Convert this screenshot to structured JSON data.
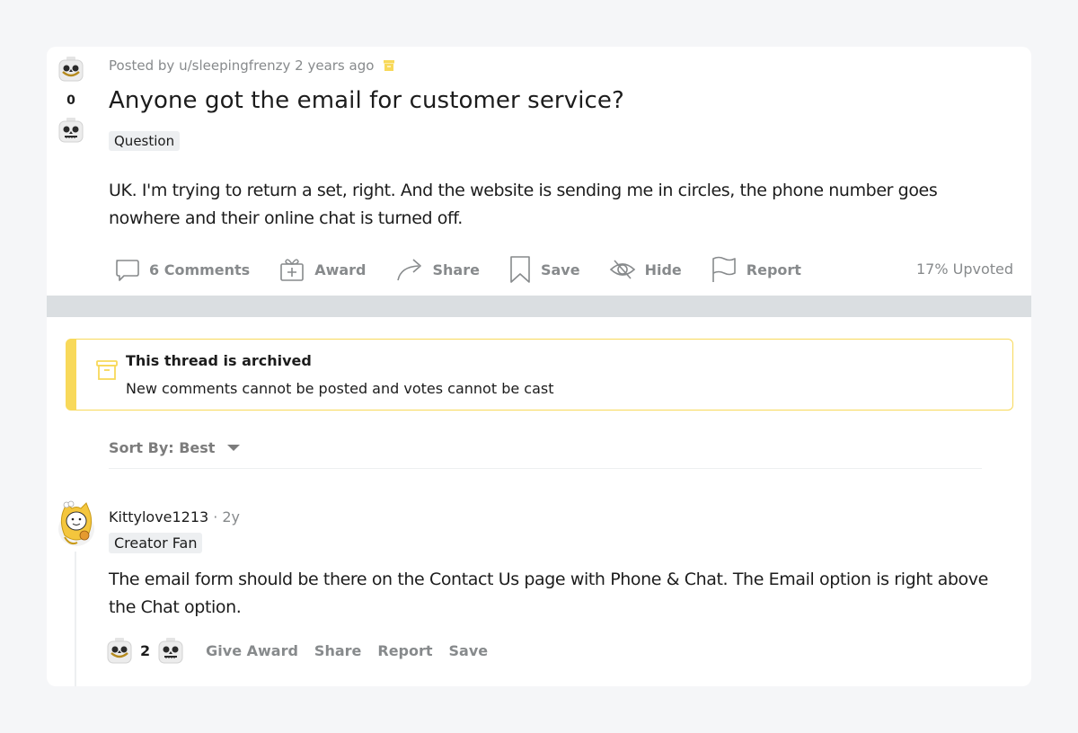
{
  "post": {
    "vote_count": "0",
    "meta": "Posted by u/sleepingfrenzy 2 years ago",
    "title": "Anyone got the email for customer service?",
    "flair": "Question",
    "body": "UK. I'm trying to return a set, right. And the website is sending me in circles, the phone number goes nowhere and their online chat is turned off.",
    "actions": {
      "comments": "6 Comments",
      "award": "Award",
      "share": "Share",
      "save": "Save",
      "hide": "Hide",
      "report": "Report"
    },
    "upvoted": "17% Upvoted",
    "icons": {
      "upvote": "lego-head-smile-icon",
      "downvote": "lego-head-skull-icon",
      "archived": "archive-box-icon"
    }
  },
  "archived_notice": {
    "title": "This thread is archived",
    "subtitle": "New comments cannot be posted and votes cannot be cast"
  },
  "sort": {
    "label": "Sort By: Best"
  },
  "comments": [
    {
      "author": "Kittylove1213",
      "separator": "·",
      "age": "2y",
      "flair": "Creator Fan",
      "body": "The email form should be there on the Contact Us page with Phone & Chat. The Email option is right above the Chat option.",
      "vote_count": "2",
      "actions": {
        "give_award": "Give Award",
        "share": "Share",
        "report": "Report",
        "save": "Save"
      }
    }
  ],
  "colors": {
    "accent_archive": "#f8d95a",
    "muted_text": "#878a8c",
    "band": "#dadee1",
    "page_bg": "#f5f6f8"
  }
}
